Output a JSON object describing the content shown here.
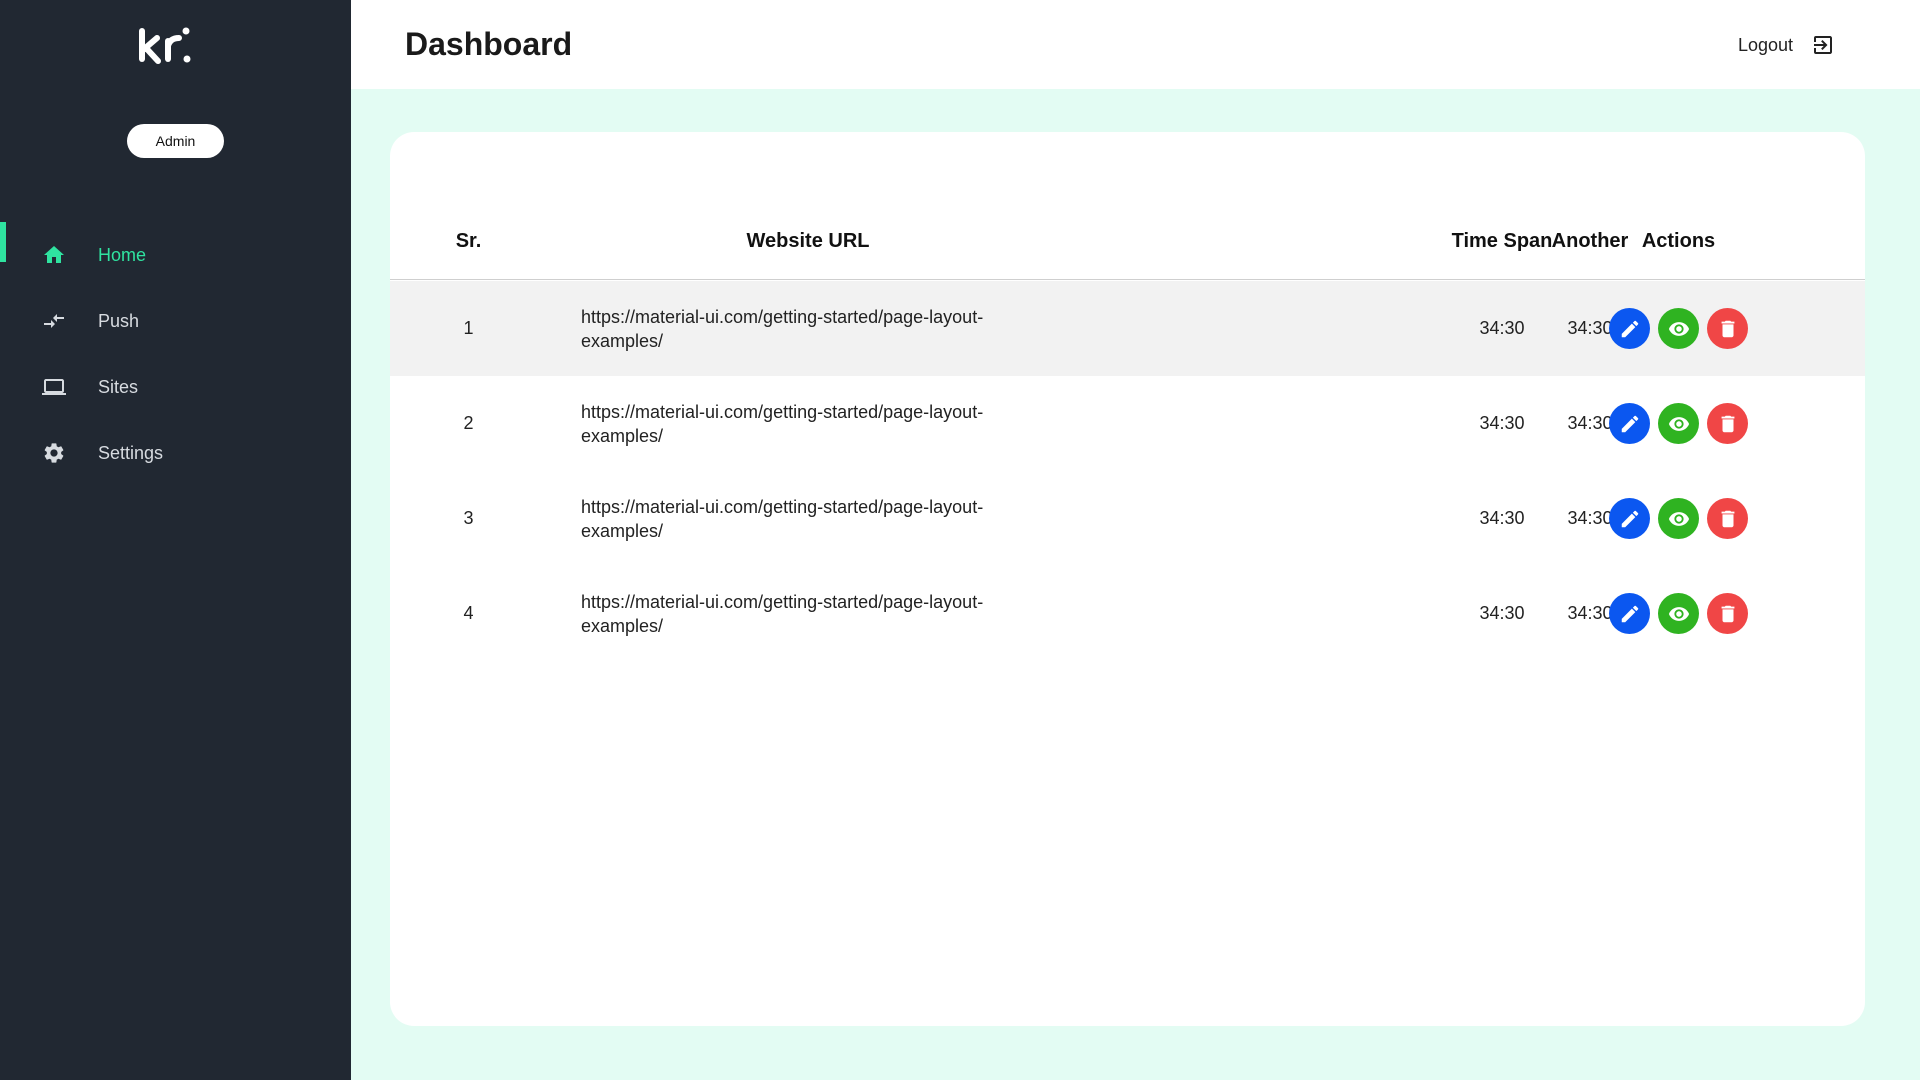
{
  "brand": {
    "logo_text": "kr."
  },
  "user": {
    "role_label": "Admin"
  },
  "sidebar": {
    "items": [
      {
        "label": "Home",
        "icon": "home-icon",
        "active": true
      },
      {
        "label": "Push",
        "icon": "push-arrows-icon",
        "active": false
      },
      {
        "label": "Sites",
        "icon": "laptop-icon",
        "active": false
      },
      {
        "label": "Settings",
        "icon": "gear-icon",
        "active": false
      }
    ]
  },
  "header": {
    "title": "Dashboard",
    "logout_label": "Logout",
    "logout_icon": "logout-icon"
  },
  "table": {
    "columns": [
      "Sr.",
      "Website URL",
      "Time Span",
      "Another",
      "Actions"
    ],
    "rows": [
      {
        "sr": "1",
        "url": "https://material-ui.com/getting-started/page-layout-examples/",
        "time_span": "34:30",
        "another": "34:30"
      },
      {
        "sr": "2",
        "url": "https://material-ui.com/getting-started/page-layout-examples/",
        "time_span": "34:30",
        "another": "34:30"
      },
      {
        "sr": "3",
        "url": "https://material-ui.com/getting-started/page-layout-examples/",
        "time_span": "34:30",
        "another": "34:30"
      },
      {
        "sr": "4",
        "url": "https://material-ui.com/getting-started/page-layout-examples/",
        "time_span": "34:30",
        "another": "34:30"
      }
    ],
    "action_icons": [
      "edit-icon",
      "view-icon",
      "delete-icon"
    ]
  },
  "colors": {
    "sidebar_bg": "#212832",
    "accent": "#2fe3a0",
    "page_bg": "#e3fcf3",
    "edit": "#0b57f0",
    "view": "#2fb321",
    "delete": "#f04646"
  }
}
